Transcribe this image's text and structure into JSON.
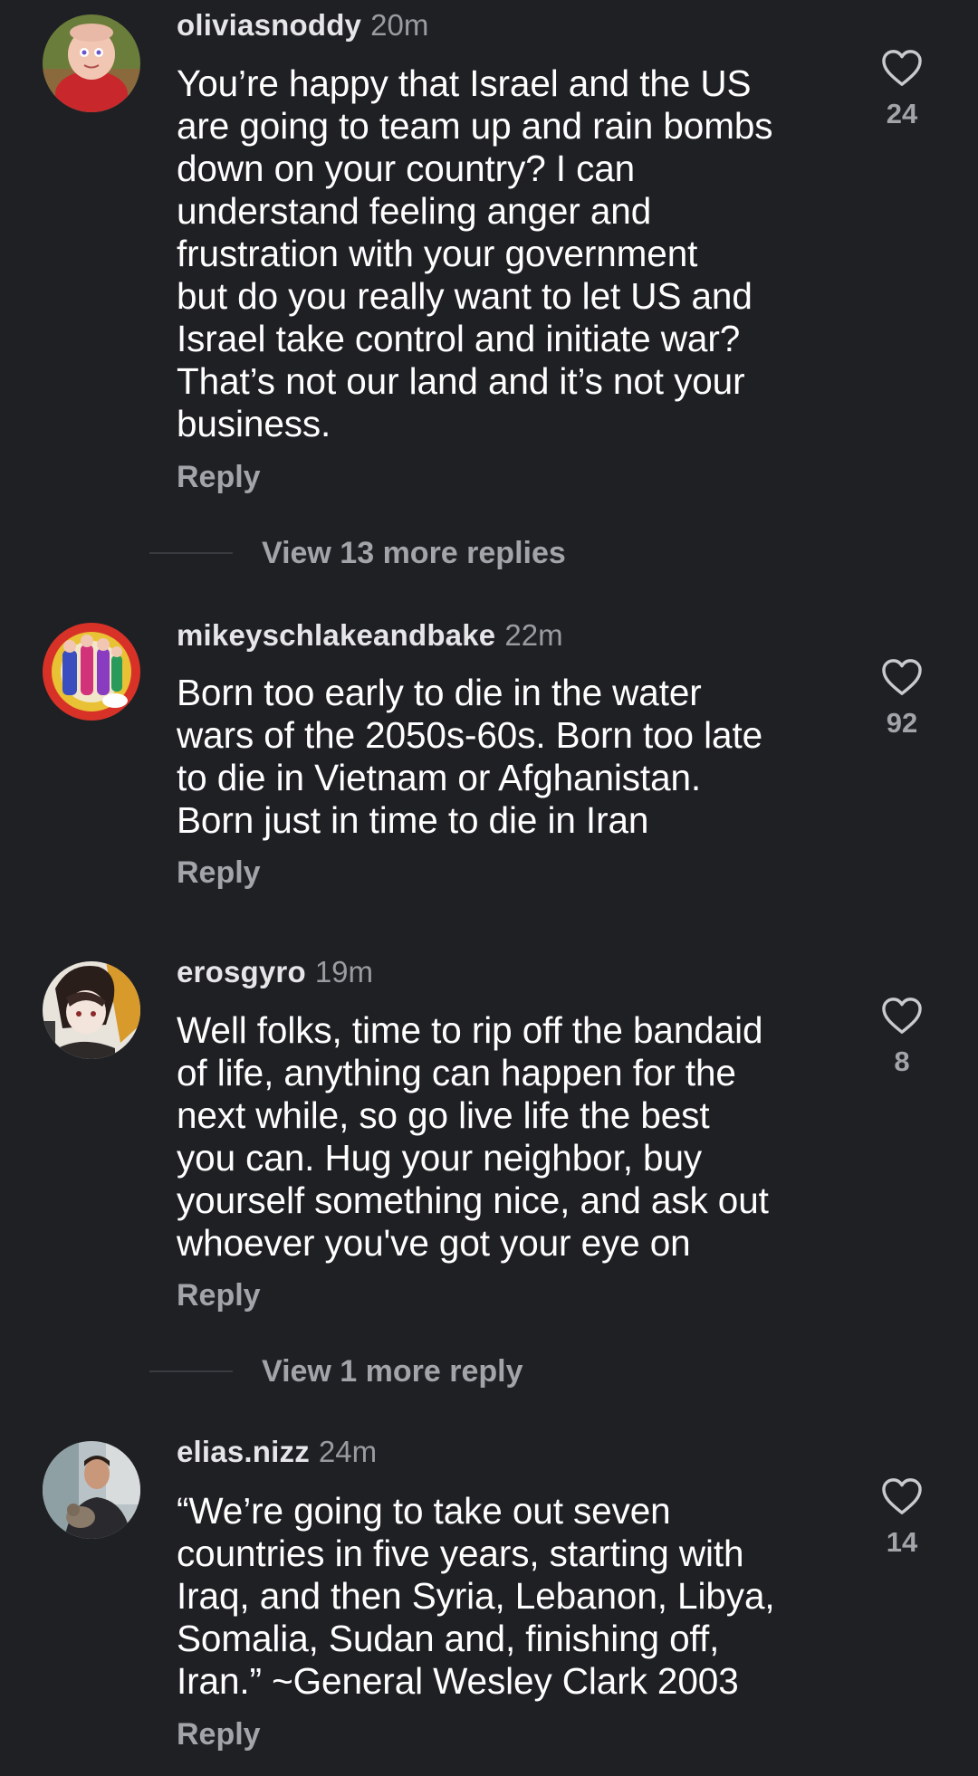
{
  "comments": [
    {
      "username": "oliviasnoddy",
      "time": "20m",
      "text": "You’re happy that Israel and the US\nare going to team up and rain bombs\ndown on your country? I can\nunderstand feeling anger and\nfrustration with your government\nbut do you really want to let US and\nIsrael take control and initiate war?\nThat’s not our land and it’s not your\nbusiness.",
      "reply_label": "Reply",
      "likes": "24",
      "avatar_icon": "cartoon-character-avatar"
    },
    {
      "username": "mikeyschlakeandbake",
      "time": "22m",
      "text": "Born too early to die in the water\nwars of the 2050s-60s. Born too late\nto die in Vietnam or Afghanistan.\nBorn just in time to die in Iran",
      "reply_label": "Reply",
      "likes": "92",
      "avatar_icon": "colorful-illustration-avatar"
    },
    {
      "username": "erosgyro",
      "time": "19m",
      "text": "Well folks, time to rip off the bandaid\nof life, anything can happen for the\nnext while, so go live life the best\nyou can. Hug your neighbor, buy\nyourself something nice, and ask out\nwhoever you've got your eye on",
      "reply_label": "Reply",
      "likes": "8",
      "avatar_icon": "anime-character-avatar"
    },
    {
      "username": "elias.nizz",
      "time": "24m",
      "text": "“We’re going to take out seven\ncountries in five years, starting with\nIraq, and then Syria, Lebanon, Libya,\nSomalia, Sudan and, finishing off,\nIran.” ~General Wesley Clark 2003",
      "reply_label": "Reply",
      "likes": "14",
      "avatar_icon": "person-photo-avatar"
    }
  ],
  "view_more": [
    {
      "label": "View 13 more replies"
    },
    {
      "label": "View 1 more reply"
    }
  ],
  "colors": {
    "background": "#1f2024",
    "text": "#ffffff",
    "secondary_text": "#a3a4a9"
  }
}
